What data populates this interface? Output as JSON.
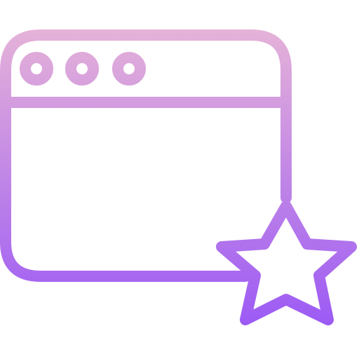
{
  "icon": {
    "name": "browser-window-star-icon",
    "parts": [
      "browser-window-icon",
      "window-dot-icon",
      "star-icon"
    ],
    "colors": {
      "gradient_top": "#E5B2D8",
      "gradient_bottom": "#9B59F5",
      "background": "#FFFFFF"
    }
  }
}
